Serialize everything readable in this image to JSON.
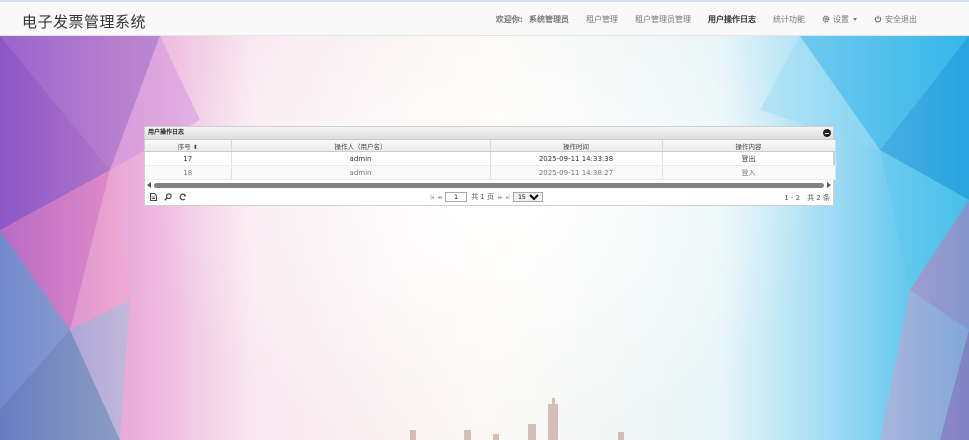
{
  "app": {
    "title": "电子发票管理系统"
  },
  "nav": {
    "welcome_prefix": "欢迎你:",
    "user_name": "系统管理员",
    "items": [
      {
        "label": "租户管理",
        "bold": false
      },
      {
        "label": "租户管理员管理",
        "bold": false
      },
      {
        "label": "用户操作日志",
        "bold": true
      },
      {
        "label": "统计功能",
        "bold": false
      }
    ],
    "settings_label": "设置",
    "logout_label": "安全退出"
  },
  "grid": {
    "title": "用户操作日志",
    "columns": [
      "序号",
      "操作人（用户名）",
      "操作时间",
      "操作内容"
    ],
    "rows": [
      {
        "id": "17",
        "user": "admin",
        "time": "2025-09-11 14:33:38",
        "action": "登出"
      },
      {
        "id": "18",
        "user": "admin",
        "time": "2025-09-11 14:38:27",
        "action": "登入"
      }
    ],
    "pager": {
      "page_value": "1",
      "total_pages_text": "共 1 页",
      "page_size": "15",
      "page_size_options": [
        "15"
      ],
      "info": "1 - 2　共 2 条"
    }
  },
  "colors": {
    "topbar_bg": "#f9f9f9",
    "grid_header": "#e3e3e3",
    "scroll_thumb": "#7f8388"
  }
}
